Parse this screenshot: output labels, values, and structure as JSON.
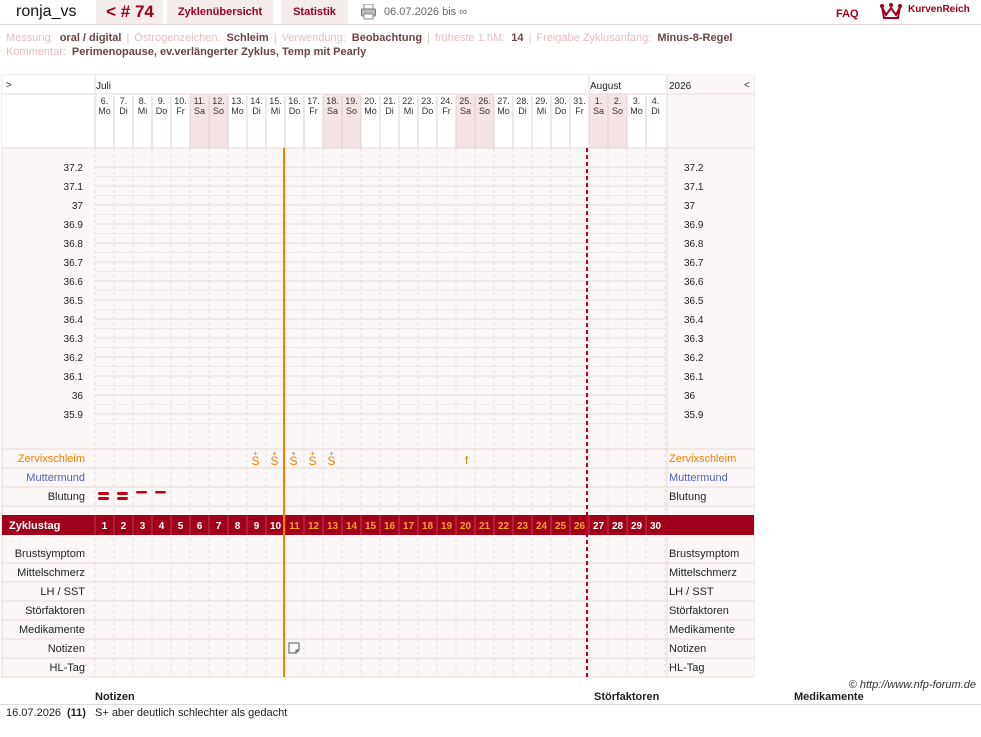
{
  "header": {
    "username": "ronja_vs",
    "cycle_label": "< # 74",
    "tabs": [
      "Zyklenübersicht",
      "Statistik"
    ],
    "date_range": "06.07.2026 bis ∞",
    "faq": "FAQ",
    "logo_text": "KurvenReich"
  },
  "meta": {
    "messung_label": "Messung:",
    "messung_value": "oral / digital",
    "oestrogen_label": "Östrogenzeichen:",
    "oestrogen_value": "Schleim",
    "verwendung_label": "Verwendung:",
    "verwendung_value": "Beobachtung",
    "frueheste_label": "früheste 1.hM:",
    "frueheste_value": "14",
    "freigabe_label": "Freigabe Zyklusanfang:",
    "freigabe_value": "Minus-8-Regel",
    "kommentar_label": "Kommentar:",
    "kommentar_value": "Perimenopause, ev.verlängerter Zyklus, Temp mit Pearly"
  },
  "chart_data": {
    "type": "table",
    "nav_prev": ">",
    "nav_next": "<",
    "year": "2026",
    "months": [
      {
        "label": "Juli",
        "col": 0
      },
      {
        "label": "August",
        "col": 26
      }
    ],
    "days": [
      {
        "d": "6.",
        "w": "Mo"
      },
      {
        "d": "7.",
        "w": "Di"
      },
      {
        "d": "8.",
        "w": "Mi"
      },
      {
        "d": "9.",
        "w": "Do"
      },
      {
        "d": "10.",
        "w": "Fr"
      },
      {
        "d": "11.",
        "w": "Sa"
      },
      {
        "d": "12.",
        "w": "So"
      },
      {
        "d": "13.",
        "w": "Mo"
      },
      {
        "d": "14.",
        "w": "Di"
      },
      {
        "d": "15.",
        "w": "Mi"
      },
      {
        "d": "16.",
        "w": "Do"
      },
      {
        "d": "17.",
        "w": "Fr"
      },
      {
        "d": "18.",
        "w": "Sa"
      },
      {
        "d": "19.",
        "w": "So"
      },
      {
        "d": "20.",
        "w": "Mo"
      },
      {
        "d": "21.",
        "w": "Di"
      },
      {
        "d": "22.",
        "w": "Mi"
      },
      {
        "d": "23.",
        "w": "Do"
      },
      {
        "d": "24.",
        "w": "Fr"
      },
      {
        "d": "25.",
        "w": "Sa"
      },
      {
        "d": "26.",
        "w": "So"
      },
      {
        "d": "27.",
        "w": "Mo"
      },
      {
        "d": "28.",
        "w": "Di"
      },
      {
        "d": "29.",
        "w": "Mi"
      },
      {
        "d": "30.",
        "w": "Do"
      },
      {
        "d": "31.",
        "w": "Fr"
      },
      {
        "d": "1.",
        "w": "Sa"
      },
      {
        "d": "2.",
        "w": "So"
      },
      {
        "d": "3.",
        "w": "Mo"
      },
      {
        "d": "4.",
        "w": "Di"
      }
    ],
    "weekend_cols": [
      5,
      6,
      12,
      13,
      19,
      20,
      26,
      27
    ],
    "temp_ticks": [
      "37.2",
      "37.1",
      "37",
      "36.9",
      "36.8",
      "36.7",
      "36.6",
      "36.5",
      "36.4",
      "36.3",
      "36.2",
      "36.1",
      "36",
      "35.9"
    ],
    "rows_top": [
      {
        "label": "Zervixschleim",
        "color": "#f08000"
      },
      {
        "label": "Muttermund",
        "color": "#5060c0"
      },
      {
        "label": "Blutung",
        "color": "#222"
      }
    ],
    "cycle_row_label": "Zyklustag",
    "cycle_days": [
      "1",
      "2",
      "3",
      "4",
      "5",
      "6",
      "7",
      "8",
      "9",
      "10",
      "11",
      "12",
      "13",
      "14",
      "15",
      "16",
      "17",
      "18",
      "19",
      "20",
      "21",
      "22",
      "23",
      "24",
      "25",
      "26",
      "27",
      "28",
      "29",
      "30"
    ],
    "rows_bottom": [
      "Brustsymptom",
      "Mittelschmerz",
      "LH / SST",
      "Störfaktoren",
      "Medikamente",
      "Notizen",
      "HL-Tag"
    ],
    "mucus": [
      {
        "col": 8,
        "sym": "S+"
      },
      {
        "col": 9,
        "sym": "S+"
      },
      {
        "col": 10,
        "sym": "S+"
      },
      {
        "col": 11,
        "sym": "S+"
      },
      {
        "col": 12,
        "sym": "S+"
      },
      {
        "col": 19,
        "sym": "f"
      }
    ],
    "bleeding": [
      {
        "col": 0,
        "level": "heavy"
      },
      {
        "col": 1,
        "level": "heavy"
      },
      {
        "col": 2,
        "level": "light"
      },
      {
        "col": 3,
        "level": "light"
      }
    ],
    "note_cols": [
      10
    ],
    "marker_col": 10,
    "cycle_start_col": 26,
    "accent": "#a0001a",
    "marker_color": "#f08000"
  },
  "footer": {
    "copyright": "© http://www.nfp-forum.de",
    "col_notizen": "Notizen",
    "col_stoerfaktoren": "Störfaktoren",
    "col_medikamente": "Medikamente",
    "note_date": "16.07.2026",
    "note_day": "(11)",
    "note_text": "S+ aber deutlich schlechter als gedacht"
  }
}
